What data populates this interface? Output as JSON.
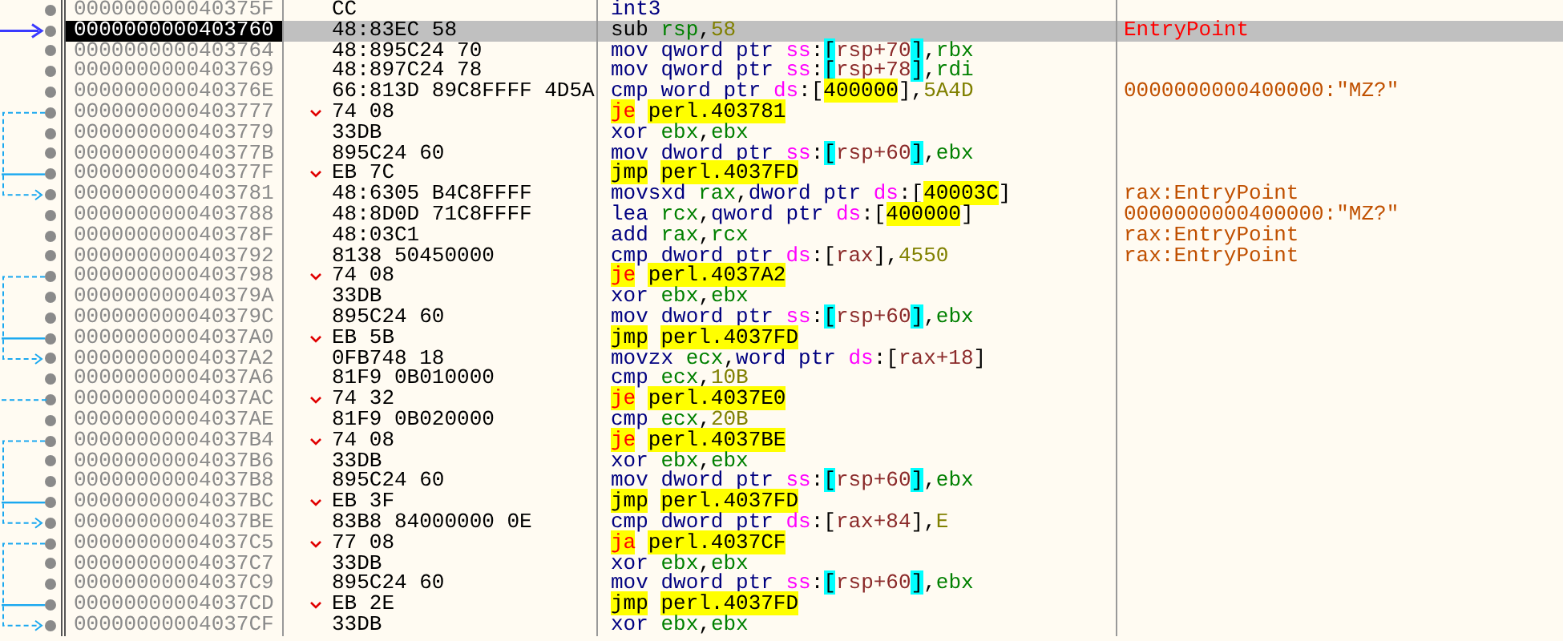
{
  "rows": [
    {
      "address": "000000000040375F",
      "bytes": "CC",
      "selected": false,
      "ip": false,
      "branch": false,
      "lands": false,
      "instruction": [
        {
          "kind": "mnemonic",
          "text": "int3"
        }
      ]
    },
    {
      "address": "0000000000403760",
      "bytes": "48:83EC 58",
      "selected": true,
      "ip": true,
      "branch": false,
      "lands": false,
      "instruction": [
        {
          "kind": "plain",
          "text": "sub "
        },
        {
          "kind": "reg",
          "text": "rsp"
        },
        {
          "kind": "punct",
          "text": ","
        },
        {
          "kind": "num",
          "text": "58"
        }
      ],
      "comment": {
        "kind": "label",
        "text": "EntryPoint"
      }
    },
    {
      "address": "0000000000403764",
      "bytes": "48:895C24 70",
      "selected": false,
      "ip": false,
      "branch": false,
      "lands": false,
      "instruction": [
        {
          "kind": "mnemonic",
          "text": "mov "
        },
        {
          "kind": "size",
          "text": "qword ptr "
        },
        {
          "kind": "seg",
          "text": "ss"
        },
        {
          "kind": "punct",
          "text": ":"
        },
        {
          "kind": "stack",
          "text": "["
        },
        {
          "kind": "memreg",
          "text": "rsp+70"
        },
        {
          "kind": "stack",
          "text": "]"
        },
        {
          "kind": "punct",
          "text": ","
        },
        {
          "kind": "reg",
          "text": "rbx"
        }
      ]
    },
    {
      "address": "0000000000403769",
      "bytes": "48:897C24 78",
      "selected": false,
      "ip": false,
      "branch": false,
      "lands": false,
      "instruction": [
        {
          "kind": "mnemonic",
          "text": "mov "
        },
        {
          "kind": "size",
          "text": "qword ptr "
        },
        {
          "kind": "seg",
          "text": "ss"
        },
        {
          "kind": "punct",
          "text": ":"
        },
        {
          "kind": "stack",
          "text": "["
        },
        {
          "kind": "memreg",
          "text": "rsp+78"
        },
        {
          "kind": "stack",
          "text": "]"
        },
        {
          "kind": "punct",
          "text": ","
        },
        {
          "kind": "reg",
          "text": "rdi"
        }
      ]
    },
    {
      "address": "000000000040376E",
      "bytes": "66:813D 89C8FFFF 4D5A",
      "selected": false,
      "ip": false,
      "branch": false,
      "lands": false,
      "instruction": [
        {
          "kind": "mnemonic",
          "text": "cmp "
        },
        {
          "kind": "size",
          "text": "word ptr "
        },
        {
          "kind": "seg",
          "text": "ds"
        },
        {
          "kind": "punct",
          "text": ":["
        },
        {
          "kind": "addr",
          "text": "400000"
        },
        {
          "kind": "punct",
          "text": "],"
        },
        {
          "kind": "num",
          "text": "5A4D"
        }
      ],
      "comment": {
        "kind": "auto",
        "text": "0000000000400000:\"MZ?\""
      }
    },
    {
      "address": "0000000000403777",
      "bytes": "74 08",
      "selected": false,
      "ip": false,
      "branch": true,
      "conditional": true,
      "lands": false,
      "instruction": [
        {
          "kind": "jcc",
          "text": "je "
        },
        {
          "kind": "target",
          "text": "perl.403781"
        }
      ]
    },
    {
      "address": "0000000000403779",
      "bytes": "33DB",
      "selected": false,
      "ip": false,
      "branch": false,
      "lands": false,
      "instruction": [
        {
          "kind": "mnemonic",
          "text": "xor "
        },
        {
          "kind": "reg",
          "text": "ebx"
        },
        {
          "kind": "punct",
          "text": ","
        },
        {
          "kind": "reg",
          "text": "ebx"
        }
      ]
    },
    {
      "address": "000000000040377B",
      "bytes": "895C24 60",
      "selected": false,
      "ip": false,
      "branch": false,
      "lands": false,
      "instruction": [
        {
          "kind": "mnemonic",
          "text": "mov "
        },
        {
          "kind": "size",
          "text": "dword ptr "
        },
        {
          "kind": "seg",
          "text": "ss"
        },
        {
          "kind": "punct",
          "text": ":"
        },
        {
          "kind": "stack",
          "text": "["
        },
        {
          "kind": "memreg",
          "text": "rsp+60"
        },
        {
          "kind": "stack",
          "text": "]"
        },
        {
          "kind": "punct",
          "text": ","
        },
        {
          "kind": "reg",
          "text": "ebx"
        }
      ]
    },
    {
      "address": "000000000040377F",
      "bytes": "EB 7C",
      "selected": false,
      "ip": false,
      "branch": true,
      "conditional": false,
      "lands": false,
      "instruction": [
        {
          "kind": "jmp",
          "text": "jmp "
        },
        {
          "kind": "target",
          "text": "perl.4037FD"
        }
      ]
    },
    {
      "address": "0000000000403781",
      "bytes": "48:6305 B4C8FFFF",
      "selected": false,
      "ip": false,
      "branch": false,
      "lands": true,
      "instruction": [
        {
          "kind": "mnemonic",
          "text": "movsxd "
        },
        {
          "kind": "reg",
          "text": "rax"
        },
        {
          "kind": "punct",
          "text": ","
        },
        {
          "kind": "size",
          "text": "dword ptr "
        },
        {
          "kind": "seg",
          "text": "ds"
        },
        {
          "kind": "punct",
          "text": ":["
        },
        {
          "kind": "addr",
          "text": "40003C"
        },
        {
          "kind": "punct",
          "text": "]"
        }
      ],
      "comment": {
        "kind": "auto",
        "text": "rax:EntryPoint"
      }
    },
    {
      "address": "0000000000403788",
      "bytes": "48:8D0D 71C8FFFF",
      "selected": false,
      "ip": false,
      "branch": false,
      "lands": false,
      "instruction": [
        {
          "kind": "mnemonic",
          "text": "lea "
        },
        {
          "kind": "reg",
          "text": "rcx"
        },
        {
          "kind": "punct",
          "text": ","
        },
        {
          "kind": "size",
          "text": "qword ptr "
        },
        {
          "kind": "seg",
          "text": "ds"
        },
        {
          "kind": "punct",
          "text": ":["
        },
        {
          "kind": "addr",
          "text": "400000"
        },
        {
          "kind": "punct",
          "text": "]"
        }
      ],
      "comment": {
        "kind": "auto",
        "text": "0000000000400000:\"MZ?\""
      }
    },
    {
      "address": "000000000040378F",
      "bytes": "48:03C1",
      "selected": false,
      "ip": false,
      "branch": false,
      "lands": false,
      "instruction": [
        {
          "kind": "mnemonic",
          "text": "add "
        },
        {
          "kind": "reg",
          "text": "rax"
        },
        {
          "kind": "punct",
          "text": ","
        },
        {
          "kind": "reg",
          "text": "rcx"
        }
      ],
      "comment": {
        "kind": "auto",
        "text": "rax:EntryPoint"
      }
    },
    {
      "address": "0000000000403792",
      "bytes": "8138 50450000",
      "selected": false,
      "ip": false,
      "branch": false,
      "lands": false,
      "instruction": [
        {
          "kind": "mnemonic",
          "text": "cmp "
        },
        {
          "kind": "size",
          "text": "dword ptr "
        },
        {
          "kind": "seg",
          "text": "ds"
        },
        {
          "kind": "punct",
          "text": ":["
        },
        {
          "kind": "memreg",
          "text": "rax"
        },
        {
          "kind": "punct",
          "text": "],"
        },
        {
          "kind": "num",
          "text": "4550"
        }
      ],
      "comment": {
        "kind": "auto",
        "text": "rax:EntryPoint"
      }
    },
    {
      "address": "0000000000403798",
      "bytes": "74 08",
      "selected": false,
      "ip": false,
      "branch": true,
      "conditional": true,
      "lands": false,
      "instruction": [
        {
          "kind": "jcc",
          "text": "je "
        },
        {
          "kind": "target",
          "text": "perl.4037A2"
        }
      ]
    },
    {
      "address": "000000000040379A",
      "bytes": "33DB",
      "selected": false,
      "ip": false,
      "branch": false,
      "lands": false,
      "instruction": [
        {
          "kind": "mnemonic",
          "text": "xor "
        },
        {
          "kind": "reg",
          "text": "ebx"
        },
        {
          "kind": "punct",
          "text": ","
        },
        {
          "kind": "reg",
          "text": "ebx"
        }
      ]
    },
    {
      "address": "000000000040379C",
      "bytes": "895C24 60",
      "selected": false,
      "ip": false,
      "branch": false,
      "lands": false,
      "instruction": [
        {
          "kind": "mnemonic",
          "text": "mov "
        },
        {
          "kind": "size",
          "text": "dword ptr "
        },
        {
          "kind": "seg",
          "text": "ss"
        },
        {
          "kind": "punct",
          "text": ":"
        },
        {
          "kind": "stack",
          "text": "["
        },
        {
          "kind": "memreg",
          "text": "rsp+60"
        },
        {
          "kind": "stack",
          "text": "]"
        },
        {
          "kind": "punct",
          "text": ","
        },
        {
          "kind": "reg",
          "text": "ebx"
        }
      ]
    },
    {
      "address": "00000000004037A0",
      "bytes": "EB 5B",
      "selected": false,
      "ip": false,
      "branch": true,
      "conditional": false,
      "lands": false,
      "instruction": [
        {
          "kind": "jmp",
          "text": "jmp "
        },
        {
          "kind": "target",
          "text": "perl.4037FD"
        }
      ]
    },
    {
      "address": "00000000004037A2",
      "bytes": "0FB748 18",
      "selected": false,
      "ip": false,
      "branch": false,
      "lands": true,
      "instruction": [
        {
          "kind": "mnemonic",
          "text": "movzx "
        },
        {
          "kind": "reg",
          "text": "ecx"
        },
        {
          "kind": "punct",
          "text": ","
        },
        {
          "kind": "size",
          "text": "word ptr "
        },
        {
          "kind": "seg",
          "text": "ds"
        },
        {
          "kind": "punct",
          "text": ":["
        },
        {
          "kind": "memreg",
          "text": "rax+18"
        },
        {
          "kind": "punct",
          "text": "]"
        }
      ]
    },
    {
      "address": "00000000004037A6",
      "bytes": "81F9 0B010000",
      "selected": false,
      "ip": false,
      "branch": false,
      "lands": false,
      "instruction": [
        {
          "kind": "mnemonic",
          "text": "cmp "
        },
        {
          "kind": "reg",
          "text": "ecx"
        },
        {
          "kind": "punct",
          "text": ","
        },
        {
          "kind": "num",
          "text": "10B"
        }
      ]
    },
    {
      "address": "00000000004037AC",
      "bytes": "74 32",
      "selected": false,
      "ip": false,
      "branch": true,
      "conditional": true,
      "lands": false,
      "instruction": [
        {
          "kind": "jcc",
          "text": "je "
        },
        {
          "kind": "target",
          "text": "perl.4037E0"
        }
      ]
    },
    {
      "address": "00000000004037AE",
      "bytes": "81F9 0B020000",
      "selected": false,
      "ip": false,
      "branch": false,
      "lands": false,
      "instruction": [
        {
          "kind": "mnemonic",
          "text": "cmp "
        },
        {
          "kind": "reg",
          "text": "ecx"
        },
        {
          "kind": "punct",
          "text": ","
        },
        {
          "kind": "num",
          "text": "20B"
        }
      ]
    },
    {
      "address": "00000000004037B4",
      "bytes": "74 08",
      "selected": false,
      "ip": false,
      "branch": true,
      "conditional": true,
      "lands": false,
      "instruction": [
        {
          "kind": "jcc",
          "text": "je "
        },
        {
          "kind": "target",
          "text": "perl.4037BE"
        }
      ]
    },
    {
      "address": "00000000004037B6",
      "bytes": "33DB",
      "selected": false,
      "ip": false,
      "branch": false,
      "lands": false,
      "instruction": [
        {
          "kind": "mnemonic",
          "text": "xor "
        },
        {
          "kind": "reg",
          "text": "ebx"
        },
        {
          "kind": "punct",
          "text": ","
        },
        {
          "kind": "reg",
          "text": "ebx"
        }
      ]
    },
    {
      "address": "00000000004037B8",
      "bytes": "895C24 60",
      "selected": false,
      "ip": false,
      "branch": false,
      "lands": false,
      "instruction": [
        {
          "kind": "mnemonic",
          "text": "mov "
        },
        {
          "kind": "size",
          "text": "dword ptr "
        },
        {
          "kind": "seg",
          "text": "ss"
        },
        {
          "kind": "punct",
          "text": ":"
        },
        {
          "kind": "stack",
          "text": "["
        },
        {
          "kind": "memreg",
          "text": "rsp+60"
        },
        {
          "kind": "stack",
          "text": "]"
        },
        {
          "kind": "punct",
          "text": ","
        },
        {
          "kind": "reg",
          "text": "ebx"
        }
      ]
    },
    {
      "address": "00000000004037BC",
      "bytes": "EB 3F",
      "selected": false,
      "ip": false,
      "branch": true,
      "conditional": false,
      "lands": false,
      "instruction": [
        {
          "kind": "jmp",
          "text": "jmp "
        },
        {
          "kind": "target",
          "text": "perl.4037FD"
        }
      ]
    },
    {
      "address": "00000000004037BE",
      "bytes": "83B8 84000000 0E",
      "selected": false,
      "ip": false,
      "branch": false,
      "lands": true,
      "instruction": [
        {
          "kind": "mnemonic",
          "text": "cmp "
        },
        {
          "kind": "size",
          "text": "dword ptr "
        },
        {
          "kind": "seg",
          "text": "ds"
        },
        {
          "kind": "punct",
          "text": ":["
        },
        {
          "kind": "memreg",
          "text": "rax+84"
        },
        {
          "kind": "punct",
          "text": "],"
        },
        {
          "kind": "num",
          "text": "E"
        }
      ]
    },
    {
      "address": "00000000004037C5",
      "bytes": "77 08",
      "selected": false,
      "ip": false,
      "branch": true,
      "conditional": true,
      "lands": false,
      "instruction": [
        {
          "kind": "jcc",
          "text": "ja "
        },
        {
          "kind": "target",
          "text": "perl.4037CF"
        }
      ]
    },
    {
      "address": "00000000004037C7",
      "bytes": "33DB",
      "selected": false,
      "ip": false,
      "branch": false,
      "lands": false,
      "instruction": [
        {
          "kind": "mnemonic",
          "text": "xor "
        },
        {
          "kind": "reg",
          "text": "ebx"
        },
        {
          "kind": "punct",
          "text": ","
        },
        {
          "kind": "reg",
          "text": "ebx"
        }
      ]
    },
    {
      "address": "00000000004037C9",
      "bytes": "895C24 60",
      "selected": false,
      "ip": false,
      "branch": false,
      "lands": false,
      "instruction": [
        {
          "kind": "mnemonic",
          "text": "mov "
        },
        {
          "kind": "size",
          "text": "dword ptr "
        },
        {
          "kind": "seg",
          "text": "ss"
        },
        {
          "kind": "punct",
          "text": ":"
        },
        {
          "kind": "stack",
          "text": "["
        },
        {
          "kind": "memreg",
          "text": "rsp+60"
        },
        {
          "kind": "stack",
          "text": "]"
        },
        {
          "kind": "punct",
          "text": ","
        },
        {
          "kind": "reg",
          "text": "ebx"
        }
      ]
    },
    {
      "address": "00000000004037CD",
      "bytes": "EB 2E",
      "selected": false,
      "ip": false,
      "branch": true,
      "conditional": false,
      "lands": false,
      "instruction": [
        {
          "kind": "jmp",
          "text": "jmp "
        },
        {
          "kind": "target",
          "text": "perl.4037FD"
        }
      ]
    },
    {
      "address": "00000000004037CF",
      "bytes": "33DB",
      "selected": false,
      "ip": false,
      "branch": false,
      "lands": true,
      "instruction": [
        {
          "kind": "mnemonic",
          "text": "xor "
        },
        {
          "kind": "reg",
          "text": "ebx"
        },
        {
          "kind": "punct",
          "text": ","
        },
        {
          "kind": "reg",
          "text": "ebx"
        }
      ]
    }
  ]
}
